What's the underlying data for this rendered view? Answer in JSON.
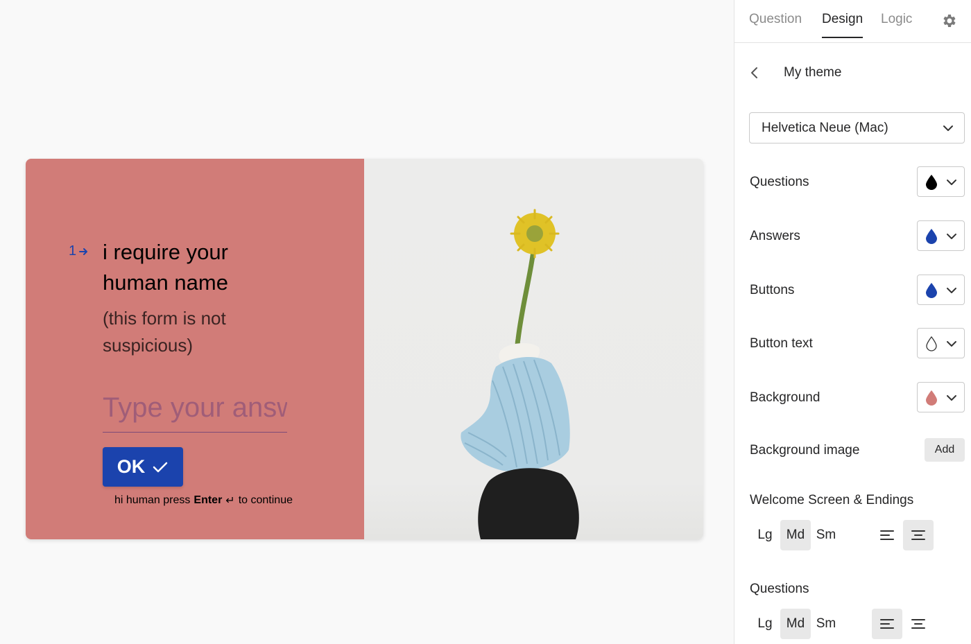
{
  "preview": {
    "question_number": "1",
    "question_title": "i require your human name",
    "question_description": "(this form is not suspicious)",
    "answer_placeholder": "Type your answer here...",
    "ok_label": "OK",
    "hint_prefix": "hi human press",
    "hint_key": "Enter",
    "hint_symbol": "↵",
    "hint_suffix": "to continue",
    "colors": {
      "background": "#d17c78",
      "question": "#000000",
      "answer": "#1b43ad",
      "button": "#1b43ad",
      "button_text": "#ffffff"
    },
    "image_description_icon": "flower-sculpture-image"
  },
  "sidebar": {
    "tabs": [
      {
        "label": "Question",
        "active": false
      },
      {
        "label": "Design",
        "active": true
      },
      {
        "label": "Logic",
        "active": false
      }
    ],
    "settings_icon": "gear-icon",
    "theme_name": "My theme",
    "font_select": "Helvetica Neue (Mac)",
    "color_rows": [
      {
        "label": "Questions",
        "color": "#000000",
        "outline": false
      },
      {
        "label": "Answers",
        "color": "#1b43ad",
        "outline": false
      },
      {
        "label": "Buttons",
        "color": "#1b43ad",
        "outline": false
      },
      {
        "label": "Button text",
        "color": "#ffffff",
        "outline": true
      },
      {
        "label": "Background",
        "color": "#d17c78",
        "outline": false
      }
    ],
    "background_image_label": "Background image",
    "add_label": "Add",
    "welcome_section": {
      "title": "Welcome Screen & Endings",
      "sizes": [
        "Lg",
        "Md",
        "Sm"
      ],
      "selected_size": "Md",
      "selected_alignment": "center"
    },
    "questions_section": {
      "title": "Questions",
      "sizes": [
        "Lg",
        "Md",
        "Sm"
      ],
      "selected_size": "Md",
      "selected_alignment": "left"
    }
  }
}
